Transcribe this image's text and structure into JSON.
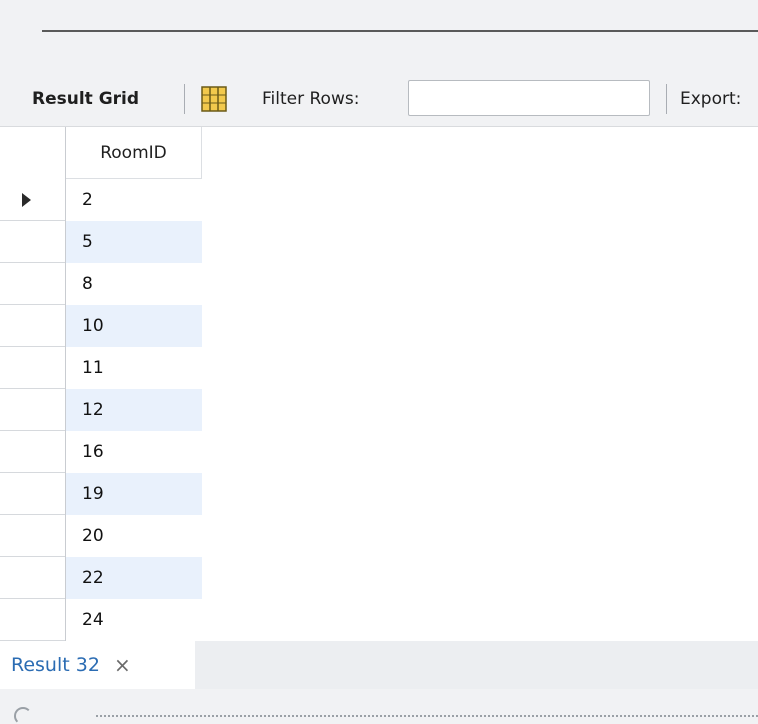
{
  "toolbar": {
    "result_grid_label": "Result Grid",
    "filter_label": "Filter Rows:",
    "filter_value": "",
    "export_label": "Export:"
  },
  "grid": {
    "column_header": "RoomID",
    "rows": [
      "2",
      "5",
      "8",
      "10",
      "11",
      "12",
      "16",
      "19",
      "20",
      "22",
      "24"
    ]
  },
  "tabs": {
    "result_tab_label": "Result 32",
    "close_glyph": "×"
  },
  "colors": {
    "alt_row": "#e9f1fc",
    "tab_label": "#2b6cb3"
  }
}
